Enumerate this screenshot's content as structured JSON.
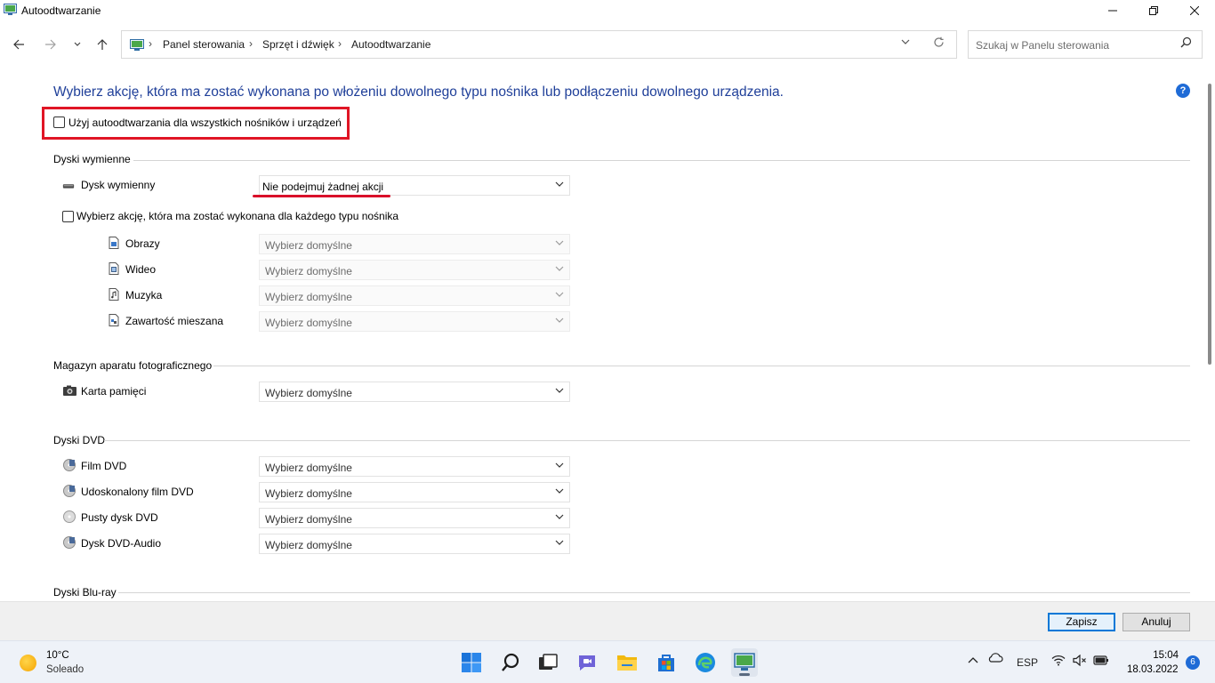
{
  "window": {
    "title": "Autoodtwarzanie"
  },
  "address": {
    "crumbs": [
      "Panel sterowania",
      "Sprzęt i dźwięk",
      "Autoodtwarzanie"
    ]
  },
  "search": {
    "placeholder": "Szukaj w Panelu sterowania"
  },
  "main": {
    "headline": "Wybierz akcję, która ma zostać wykonana po włożeniu dowolnego typu nośnika lub podłączeniu dowolnego urządzenia.",
    "use_autoplay_label": "Użyj autoodtwarzania dla wszystkich nośników i urządzeń",
    "use_autoplay_checked": false,
    "accent_color": "#1f3f99",
    "highlight_color": "#e01525"
  },
  "removable": {
    "title": "Dyski wymienne",
    "drive_label": "Dysk wymienny",
    "drive_value": "Nie podejmuj żadnej akcji",
    "per_type_label": "Wybierz akcję, która ma zostać wykonana dla każdego typu nośnika",
    "per_type_checked": false,
    "items": [
      {
        "label": "Obrazy",
        "value": "Wybierz domyślne",
        "icon": "picture-file-icon"
      },
      {
        "label": "Wideo",
        "value": "Wybierz domyślne",
        "icon": "video-file-icon"
      },
      {
        "label": "Muzyka",
        "value": "Wybierz domyślne",
        "icon": "music-file-icon"
      },
      {
        "label": "Zawartość mieszana",
        "value": "Wybierz domyślne",
        "icon": "mixed-file-icon"
      }
    ]
  },
  "camera": {
    "title": "Magazyn aparatu fotograficznego",
    "items": [
      {
        "label": "Karta pamięci",
        "value": "Wybierz domyślne",
        "icon": "camera-icon"
      }
    ]
  },
  "dvd": {
    "title": "Dyski DVD",
    "items": [
      {
        "label": "Film DVD",
        "value": "Wybierz domyślne",
        "icon": "dvd-video-icon"
      },
      {
        "label": "Udoskonalony film DVD",
        "value": "Wybierz domyślne",
        "icon": "dvd-video-icon"
      },
      {
        "label": "Pusty dysk DVD",
        "value": "Wybierz domyślne",
        "icon": "blank-disc-icon"
      },
      {
        "label": "Dysk DVD-Audio",
        "value": "Wybierz domyślne",
        "icon": "dvd-audio-icon"
      }
    ]
  },
  "bluray": {
    "title": "Dyski Blu-ray"
  },
  "footer": {
    "save_label": "Zapisz",
    "cancel_label": "Anuluj"
  },
  "taskbar": {
    "weather_temp": "10°C",
    "weather_desc": "Soleado",
    "language": "ESP",
    "time": "15:04",
    "date": "18.03.2022",
    "notifications": "6",
    "apps": [
      "start-icon",
      "search-icon",
      "task-view-icon",
      "chat-icon",
      "file-explorer-icon",
      "store-icon",
      "edge-icon",
      "control-panel-icon"
    ]
  }
}
